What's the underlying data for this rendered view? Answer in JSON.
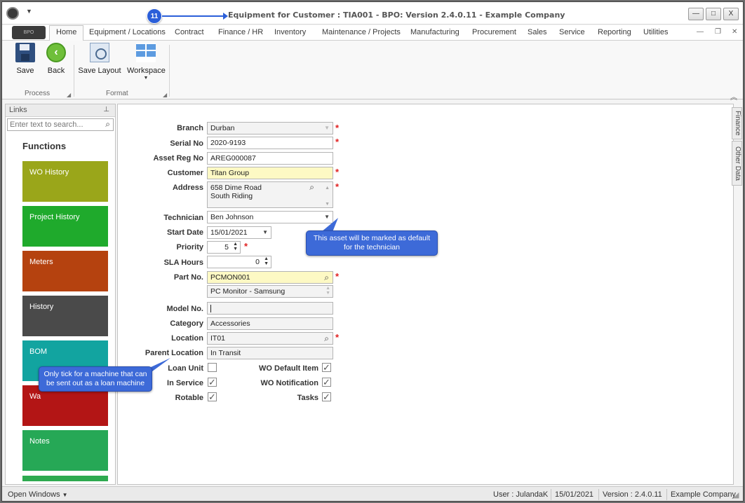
{
  "window": {
    "title": "Equipment for Customer : TIA001 - BPO: Version 2.4.0.11 - Example Company",
    "step_number": "11",
    "logo_text": "BPO",
    "controls": {
      "minimize": "—",
      "maximize": "□",
      "close": "X"
    }
  },
  "ribbon_tabs": [
    "Home",
    "Equipment / Locations",
    "Contract",
    "Finance / HR",
    "Inventory",
    "Maintenance / Projects",
    "Manufacturing",
    "Procurement",
    "Sales",
    "Service",
    "Reporting",
    "Utilities"
  ],
  "ribbon": {
    "buttons": {
      "save": "Save",
      "back": "Back",
      "save_layout": "Save Layout",
      "workspace": "Workspace"
    },
    "groups": {
      "process": "Process",
      "format": "Format"
    }
  },
  "links_panel": {
    "header": "Links",
    "search_placeholder": "Enter text to search...",
    "functions_title": "Functions",
    "tiles": [
      {
        "label": "WO History",
        "color": "#9aa61a"
      },
      {
        "label": "Project History",
        "color": "#1faa2c"
      },
      {
        "label": "Meters",
        "color": "#b5420f"
      },
      {
        "label": "History",
        "color": "#4a4a4a"
      },
      {
        "label": "BOM",
        "color": "#12a4a0"
      },
      {
        "label": "Wa",
        "color": "#b31515"
      },
      {
        "label": "Notes",
        "color": "#26a856"
      }
    ]
  },
  "form": {
    "branch": {
      "label": "Branch",
      "value": "Durban"
    },
    "serial_no": {
      "label": "Serial No",
      "value": "2020-9193"
    },
    "asset_reg_no": {
      "label": "Asset Reg No",
      "value": "AREG000087"
    },
    "customer": {
      "label": "Customer",
      "value": "Titan Group"
    },
    "address": {
      "label": "Address",
      "line1": "658 Dime Road",
      "line2": "South Riding"
    },
    "technician": {
      "label": "Technician",
      "value": "Ben Johnson"
    },
    "start_date": {
      "label": "Start Date",
      "value": "15/01/2021"
    },
    "priority": {
      "label": "Priority",
      "value": "5"
    },
    "sla_hours": {
      "label": "SLA Hours",
      "value": "0"
    },
    "part_no": {
      "label": "Part No.",
      "value": "PCMON001",
      "description": "PC Monitor - Samsung"
    },
    "model_no": {
      "label": "Model No.",
      "value": ""
    },
    "category": {
      "label": "Category",
      "value": "Accessories"
    },
    "location": {
      "label": "Location",
      "value": "IT01"
    },
    "parent_location": {
      "label": "Parent Location",
      "value": "In Transit"
    },
    "checkboxes": {
      "loan_unit": {
        "label": "Loan Unit",
        "checked": false
      },
      "in_service": {
        "label": "In Service",
        "checked": true
      },
      "rotable": {
        "label": "Rotable",
        "checked": true
      },
      "wo_default_item": {
        "label": "WO Default Item",
        "checked": true
      },
      "wo_notification": {
        "label": "WO Notification",
        "checked": true
      },
      "tasks": {
        "label": "Tasks",
        "checked": true
      }
    }
  },
  "callouts": {
    "technician": "This asset will be marked as default for the technician",
    "loan_unit": "Only tick for a machine that can be sent out as a loan machine"
  },
  "side_tabs": [
    "Finance",
    "Other Data"
  ],
  "statusbar": {
    "open_windows": "Open Windows",
    "user": "User : JulandaK",
    "date": "15/01/2021",
    "version": "Version : 2.4.0.11",
    "company": "Example Company"
  }
}
